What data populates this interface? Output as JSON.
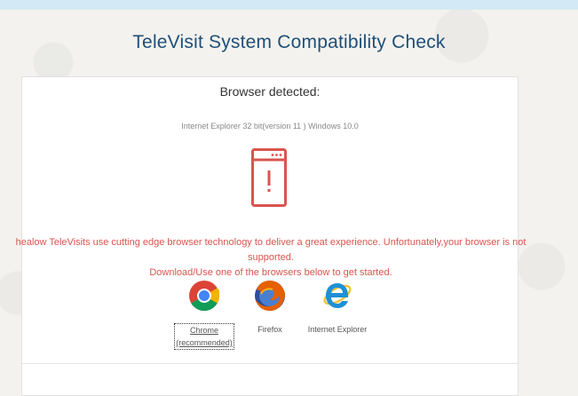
{
  "page": {
    "title": "TeleVisit System Compatibility Check"
  },
  "detection": {
    "heading": "Browser detected:",
    "browser_info": "Internet Explorer 32 bit(version 11 ) Windows 10.0"
  },
  "message": {
    "line1": "healow TeleVisits use cutting edge browser technology to deliver a great experience. Unfortunately,your browser is not supported.",
    "line2": "Download/Use one of the browsers below to get started."
  },
  "browsers": [
    {
      "name": "Chrome",
      "note": "(recommended)",
      "icon": "chrome-icon"
    },
    {
      "name": "Firefox",
      "icon": "firefox-icon"
    },
    {
      "name": "Internet Explorer",
      "icon": "internet-explorer-icon"
    }
  ],
  "colors": {
    "title": "#1f4f78",
    "warning": "#d9544f",
    "top_strip": "#d3e9f5"
  }
}
